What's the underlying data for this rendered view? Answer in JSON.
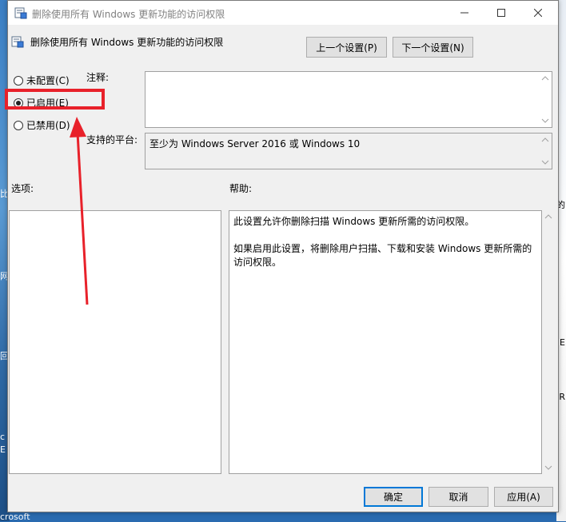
{
  "window": {
    "title": "删除使用所有 Windows 更新功能的访问权限"
  },
  "header": {
    "policy_name": "删除使用所有 Windows 更新功能的访问权限",
    "prev_button": "上一个设置(P)",
    "next_button": "下一个设置(N)"
  },
  "state_options": [
    {
      "label": "未配置(C)",
      "checked": false
    },
    {
      "label": "已启用(E)",
      "checked": true
    },
    {
      "label": "已禁用(D)",
      "checked": false
    }
  ],
  "comment": {
    "label": "注释:",
    "value": ""
  },
  "platform": {
    "label": "支持的平台:",
    "value": "至少为 Windows Server 2016 或 Windows 10"
  },
  "options_panel": {
    "label": "选项:"
  },
  "help_panel": {
    "label": "帮助:",
    "paragraphs": [
      "此设置允许你删除扫描 Windows 更新所需的访问权限。",
      "如果启用此设置，将删除用户扫描、下载和安装 Windows 更新所需的访问权限。"
    ]
  },
  "footer": {
    "ok_button": "确定",
    "cancel_button": "取消",
    "apply_button": "应用(A)"
  },
  "background_fragments": {
    "left": [
      "比",
      "网",
      "回",
      "c",
      "E",
      "crosoft"
    ],
    "right": [
      "的",
      "E",
      "R"
    ]
  },
  "colors": {
    "annotation_red": "#e8212a",
    "primary_button_border": "#0078d7"
  },
  "icons": {
    "title": "policy-icon",
    "header": "policy-icon",
    "minimize": "minimize-icon",
    "maximize": "maximize-icon",
    "close": "close-icon"
  }
}
